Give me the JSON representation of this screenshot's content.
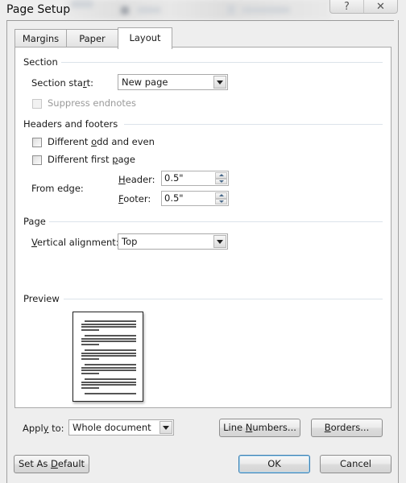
{
  "window": {
    "title": "Page Setup",
    "help_icon": "help-icon",
    "close_icon": "close-icon"
  },
  "tabs": [
    {
      "label": "Margins",
      "active": false
    },
    {
      "label": "Paper",
      "active": false
    },
    {
      "label": "Layout",
      "active": true
    }
  ],
  "section": {
    "heading": "Section",
    "section_start_label_pre": "Section sta",
    "section_start_label_key": "r",
    "section_start_label_post": "t:",
    "section_start_value": "New page",
    "suppress_endnotes_label": "Suppress endnotes",
    "suppress_endnotes_checked": false,
    "suppress_endnotes_enabled": false
  },
  "headers_footers": {
    "heading": "Headers and footers",
    "odd_even_pre": "Different ",
    "odd_even_key": "o",
    "odd_even_post": "dd and even",
    "odd_even_checked": false,
    "first_page_pre": "Different first ",
    "first_page_key": "p",
    "first_page_post": "age",
    "first_page_checked": false,
    "from_edge_label": "From edge:",
    "header_key": "H",
    "header_rest": "eader:",
    "header_value": "0.5\"",
    "footer_key": "F",
    "footer_rest": "ooter:",
    "footer_value": "0.5\""
  },
  "page": {
    "heading": "Page",
    "vertical_alignment_key": "V",
    "vertical_alignment_rest": "ertical alignment:",
    "vertical_alignment_value": "Top"
  },
  "preview": {
    "heading": "Preview"
  },
  "apply": {
    "label_pre": "Appl",
    "label_key": "y",
    "label_post": " to:",
    "value": "Whole document"
  },
  "buttons": {
    "line_numbers_pre": "Line ",
    "line_numbers_key": "N",
    "line_numbers_post": "umbers...",
    "borders_key": "B",
    "borders_post": "orders...",
    "set_default_pre": "Set As ",
    "set_default_key": "D",
    "set_default_post": "efault",
    "ok": "OK",
    "cancel": "Cancel"
  }
}
